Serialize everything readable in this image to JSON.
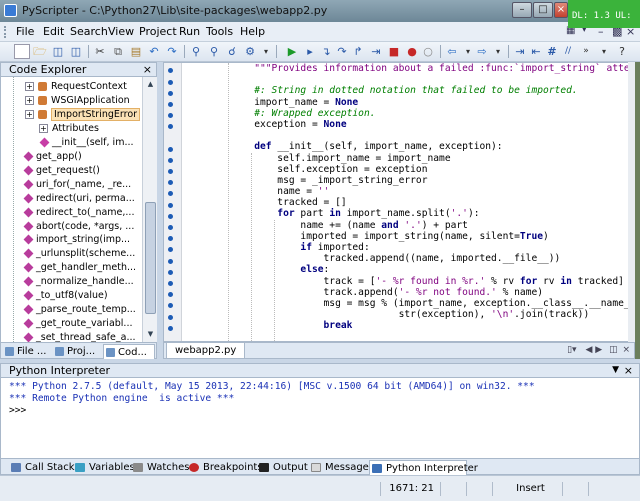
{
  "window": {
    "title": "PyScripter - C:\\Python27\\Lib\\site-packages\\webapp2.py",
    "controls": [
      "min-icon",
      "max-icon",
      "close-icon"
    ]
  },
  "tray_widget": {
    "line1": "",
    "line2": "DL: 1.3 UL:"
  },
  "menu": [
    "File",
    "Edit",
    "Search",
    "View",
    "Project",
    "Run",
    "Tools",
    "Help"
  ],
  "code_explorer": {
    "title": "Code Explorer",
    "items": [
      {
        "label": "RequestContext",
        "kind": "class",
        "indent": 1
      },
      {
        "label": "WSGIApplication",
        "kind": "class",
        "indent": 1
      },
      {
        "label": "ImportStringError",
        "kind": "class",
        "indent": 1,
        "selected": true
      },
      {
        "label": "Attributes",
        "kind": "group",
        "indent": 2
      },
      {
        "label": "__init__(self, im...",
        "kind": "method",
        "indent": 3
      },
      {
        "label": "get_app()",
        "kind": "function",
        "indent": 1
      },
      {
        "label": "get_request()",
        "kind": "function",
        "indent": 1
      },
      {
        "label": "uri_for(_name, _re...",
        "kind": "function",
        "indent": 1
      },
      {
        "label": "redirect(uri, perma...",
        "kind": "function",
        "indent": 1
      },
      {
        "label": "redirect_to(_name,...",
        "kind": "function",
        "indent": 1
      },
      {
        "label": "abort(code, *args, ...",
        "kind": "function",
        "indent": 1
      },
      {
        "label": "import_string(imp...",
        "kind": "function",
        "indent": 1
      },
      {
        "label": "_urlunsplit(scheme...",
        "kind": "function",
        "indent": 1
      },
      {
        "label": "_get_handler_meth...",
        "kind": "function",
        "indent": 1
      },
      {
        "label": "_normalize_handle...",
        "kind": "function",
        "indent": 1
      },
      {
        "label": "_to_utf8(value)",
        "kind": "function",
        "indent": 1
      },
      {
        "label": "_parse_route_temp...",
        "kind": "function",
        "indent": 1
      },
      {
        "label": "_get_route_variabl...",
        "kind": "function",
        "indent": 1
      },
      {
        "label": "_set_thread_safe_a...",
        "kind": "function",
        "indent": 1
      }
    ],
    "tabs": [
      "File ...",
      "Proj...",
      "Cod..."
    ]
  },
  "editor": {
    "tab": "webapp2.py",
    "lines": [
      [
        [
          "str",
          "        \"\"\"Provides information about a failed :func:`import_string` attempt.\"\"\""
        ]
      ],
      [
        [
          "op",
          ""
        ]
      ],
      [
        [
          "com",
          "        #: String in dotted notation that failed to be imported."
        ]
      ],
      [
        [
          "op",
          "        import_name = "
        ],
        [
          "kw",
          "None"
        ]
      ],
      [
        [
          "com",
          "        #: Wrapped exception."
        ]
      ],
      [
        [
          "op",
          "        exception = "
        ],
        [
          "kw",
          "None"
        ]
      ],
      [
        [
          "op",
          ""
        ]
      ],
      [
        [
          "kw",
          "        def "
        ],
        [
          "op",
          "__init__(self, import_name, exception):"
        ]
      ],
      [
        [
          "op",
          "            self.import_name = import_name"
        ]
      ],
      [
        [
          "op",
          "            self.exception = exception"
        ]
      ],
      [
        [
          "op",
          "            msg = _import_string_error"
        ]
      ],
      [
        [
          "op",
          "            name = "
        ],
        [
          "str",
          "''"
        ]
      ],
      [
        [
          "op",
          "            tracked = []"
        ]
      ],
      [
        [
          "kw",
          "            for "
        ],
        [
          "op",
          "part "
        ],
        [
          "kw",
          "in "
        ],
        [
          "op",
          "import_name.split("
        ],
        [
          "str",
          "'.'"
        ],
        [
          "op",
          "):"
        ]
      ],
      [
        [
          "op",
          "                name += (name "
        ],
        [
          "kw",
          "and "
        ],
        [
          "str",
          "'.'"
        ],
        [
          "op",
          ") + part"
        ]
      ],
      [
        [
          "op",
          "                imported = import_string(name, silent="
        ],
        [
          "kw",
          "True"
        ],
        [
          "op",
          ")"
        ]
      ],
      [
        [
          "kw",
          "                if "
        ],
        [
          "op",
          "imported:"
        ]
      ],
      [
        [
          "op",
          "                    tracked.append((name, imported.__file__))"
        ]
      ],
      [
        [
          "kw",
          "                else"
        ],
        [
          "op",
          ":"
        ]
      ],
      [
        [
          "op",
          "                    track = ["
        ],
        [
          "str",
          "'- %r found in %r.'"
        ],
        [
          "op",
          " % rv "
        ],
        [
          "kw",
          "for "
        ],
        [
          "op",
          "rv "
        ],
        [
          "kw",
          "in "
        ],
        [
          "op",
          "tracked]"
        ]
      ],
      [
        [
          "op",
          "                    track.append("
        ],
        [
          "str",
          "'- %r not found.'"
        ],
        [
          "op",
          " % name)"
        ]
      ],
      [
        [
          "op",
          "                    msg = msg % (import_name, exception.__class__.__name__,"
        ]
      ],
      [
        [
          "op",
          "                                 str(exception), "
        ],
        [
          "str",
          "'\\n'"
        ],
        [
          "op",
          ".join(track))"
        ]
      ],
      [
        [
          "kw",
          "                    break"
        ]
      ]
    ]
  },
  "python_interpreter": {
    "title": "Python Interpreter",
    "lines": [
      "*** Python 2.7.5 (default, May 15 2013, 22:44:16) [MSC v.1500 64 bit (AMD64)] on win32. ***",
      "*** Remote Python engine  is active ***",
      ">>>"
    ]
  },
  "bottom_tabs": [
    "Call Stack",
    "Variables",
    "Watches",
    "Breakpoints",
    "Output",
    "Messages",
    "Python Interpreter"
  ],
  "status": {
    "position": "1671: 21",
    "mode": "Insert"
  }
}
